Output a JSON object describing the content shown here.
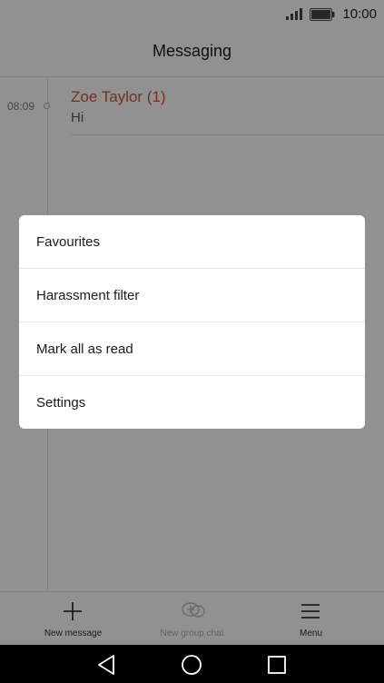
{
  "status_bar": {
    "time": "10:00"
  },
  "header": {
    "title": "Messaging"
  },
  "thread": {
    "time": "08:09",
    "name": "Zoe Taylor (1)",
    "preview": "Hi"
  },
  "bottom_bar": {
    "actions": [
      {
        "label": "New message",
        "icon": "plus-icon",
        "enabled": true
      },
      {
        "label": "New group chat",
        "icon": "group-chat-icon",
        "enabled": false
      },
      {
        "label": "Menu",
        "icon": "menu-icon",
        "enabled": true
      }
    ]
  },
  "menu": {
    "items": [
      {
        "label": "Favourites"
      },
      {
        "label": "Harassment filter"
      },
      {
        "label": "Mark all as read"
      },
      {
        "label": "Settings"
      }
    ]
  },
  "colors": {
    "accent": "#d35230",
    "scrim": "#000000"
  },
  "nav_bar": {
    "icons": [
      "back-icon",
      "home-icon",
      "recents-icon"
    ]
  }
}
